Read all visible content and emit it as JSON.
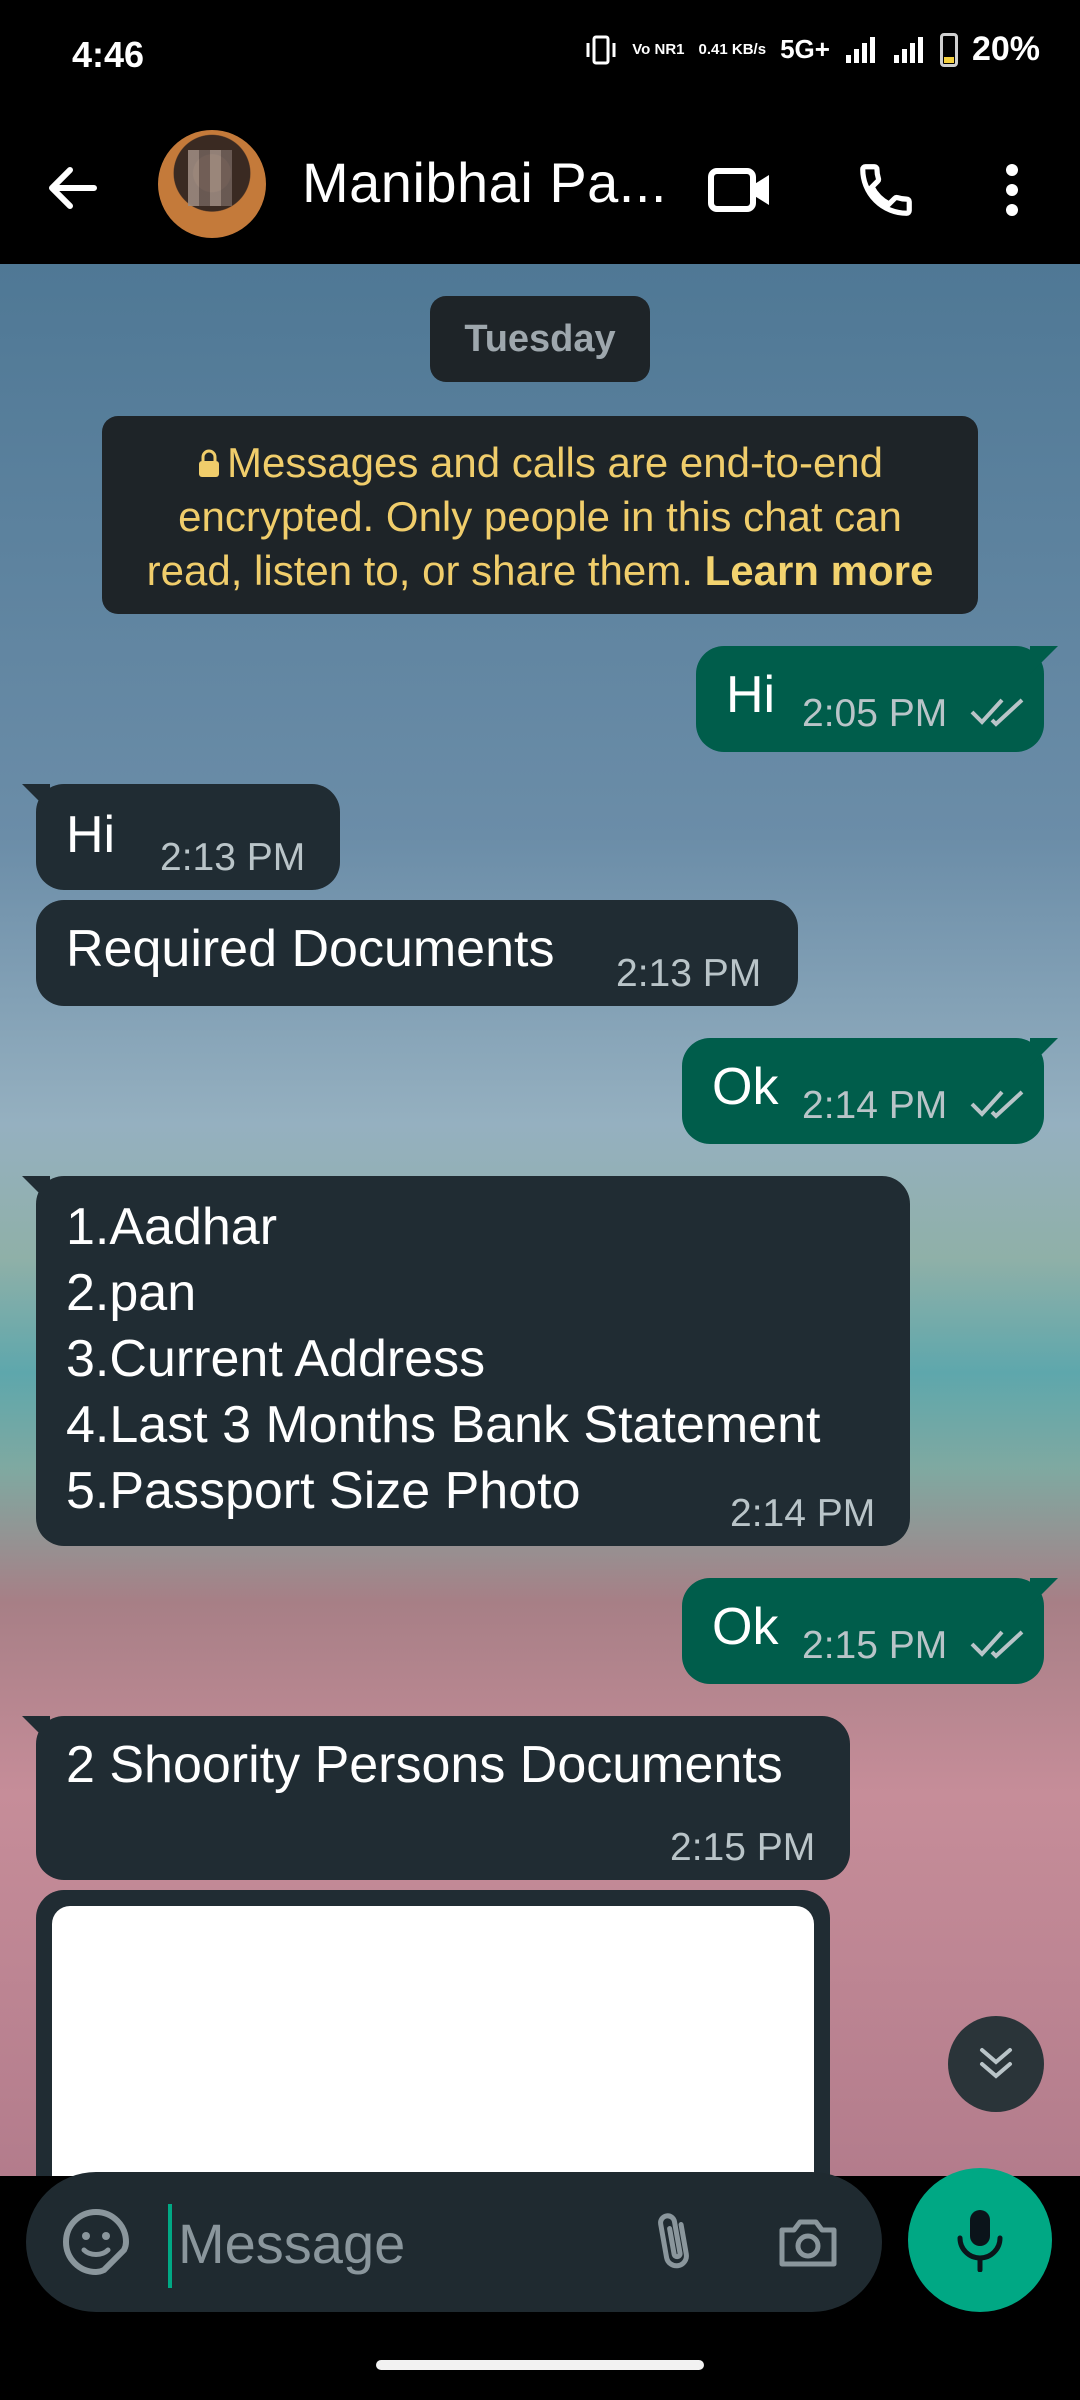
{
  "status_bar": {
    "time": "4:46",
    "volte": "Vo NR1",
    "speed": "0.41 KB/s",
    "network": "5G+",
    "battery": "20%"
  },
  "header": {
    "contact_name": "Manibhai Pa..."
  },
  "chat": {
    "date_chip": "Tuesday",
    "encryption_notice": "Messages and calls are end-to-end encrypted. Only people in this chat can read, listen to, or share them.",
    "learn_more": "Learn more",
    "messages": [
      {
        "direction": "outgoing",
        "text": "Hi",
        "time": "2:05 PM",
        "status": "read"
      },
      {
        "direction": "incoming",
        "text": "Hi",
        "time": "2:13 PM"
      },
      {
        "direction": "incoming",
        "text": "Required Documents",
        "time": "2:13 PM"
      },
      {
        "direction": "outgoing",
        "text": "Ok",
        "time": "2:14 PM",
        "status": "read"
      },
      {
        "direction": "incoming",
        "text": "1.Aadhar\n2.pan\n3.Current Address\n4.Last 3 Months Bank Statement\n5.Passport Size Photo",
        "time": "2:14 PM"
      },
      {
        "direction": "outgoing",
        "text": "Ok",
        "time": "2:15 PM",
        "status": "read"
      },
      {
        "direction": "incoming",
        "text": "2 Shoority Persons Documents",
        "time": "2:15 PM"
      }
    ]
  },
  "composer": {
    "placeholder": "Message"
  },
  "colors": {
    "outgoing_bubble": "#005d4b",
    "incoming_bubble": "#202c33",
    "accent": "#00a884",
    "read_ticks": "#b9c4c8"
  },
  "icons": [
    "back-arrow-icon",
    "video-call-icon",
    "phone-icon",
    "more-options-icon",
    "lock-icon",
    "double-check-icon",
    "scroll-down-icon",
    "sticker-icon",
    "paperclip-icon",
    "camera-icon",
    "mic-icon"
  ]
}
